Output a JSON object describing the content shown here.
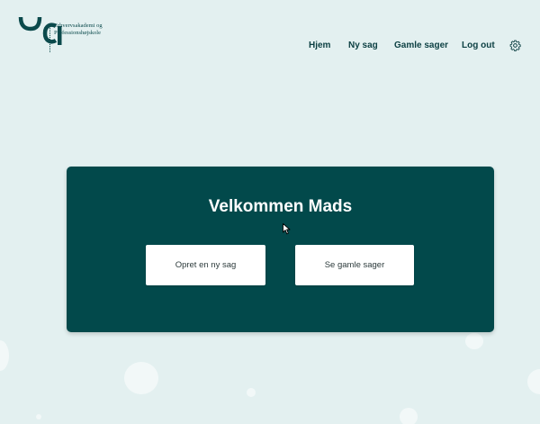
{
  "logo": {
    "line1": "Erhvervsakademi og",
    "line2": "Professionshøjskole"
  },
  "nav": {
    "items": [
      {
        "label": "Hjem"
      },
      {
        "label": "Ny sag"
      },
      {
        "label": "Gamle sager"
      },
      {
        "label": "Log out"
      }
    ],
    "settings_icon": "gear-icon"
  },
  "welcome": {
    "title": "Velkommen Mads",
    "new_case_label": "Opret en ny sag",
    "old_cases_label": "Se gamle sager"
  },
  "colors": {
    "background": "#e3f0f0",
    "card": "#02494b",
    "brand": "#0b4a4c"
  }
}
